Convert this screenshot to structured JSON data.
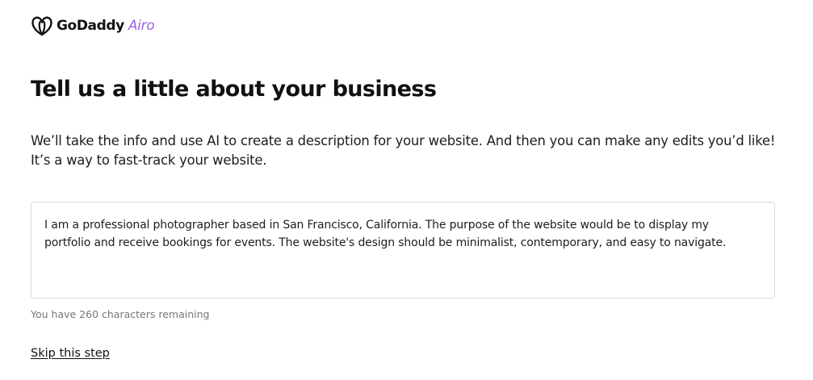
{
  "brand": {
    "name": "GoDaddy",
    "product": "Airo",
    "icon": "godaddy-logo-icon",
    "colors": {
      "text": "#111111",
      "accent": "#9a63e3"
    }
  },
  "page": {
    "title": "Tell us a little about your business",
    "intro_lines": [
      "We’ll take the info and use AI to create a description for your website. And then you can make any edits you’d like!",
      "It’s a way to fast-track your website."
    ]
  },
  "description_field": {
    "value_lines": [
      "I am a professional photographer based in San Francisco, California. The purpose of the website would be to display my",
      "portfolio and receive bookings for events. The website's design should be minimalist, contemporary, and easy to navigate."
    ],
    "helper_text": "You have 260 characters remaining"
  },
  "actions": {
    "skip_label": "Skip this step"
  }
}
